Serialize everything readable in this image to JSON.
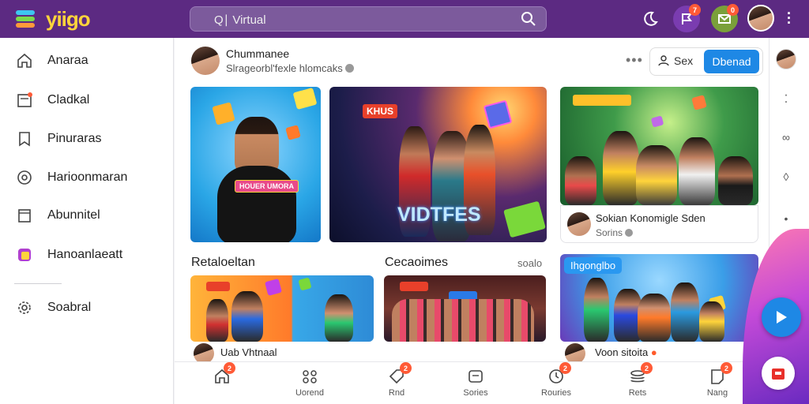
{
  "app": {
    "brand": "yiigo",
    "brand_color": "#ffd43b",
    "topbar_color": "#5c2a82",
    "accent": "#1e88e5"
  },
  "search": {
    "value": "Q∣ Virtual"
  },
  "topbar": {
    "notifications_badge": "7",
    "messages_badge": "0"
  },
  "sidebar": {
    "items": [
      {
        "label": "Anaraa",
        "icon": "home-icon"
      },
      {
        "label": "Cladkal",
        "icon": "inbox-icon"
      },
      {
        "label": "Pinuraras",
        "icon": "bookmark-icon"
      },
      {
        "label": "Harioonmaran",
        "icon": "target-icon"
      },
      {
        "label": "Abunnitel",
        "icon": "calendar-icon"
      },
      {
        "label": "Hanoanlaeatt",
        "icon": "app-icon"
      },
      {
        "label": "Soabral",
        "icon": "gear-icon"
      }
    ]
  },
  "post": {
    "author": "Chummanee",
    "subtitle": "Slrageorbl'fexle hlomcaks",
    "secondary_button": "Sex",
    "primary_button": "Dbenad"
  },
  "featured": {
    "img1_banner": "HOUER UMORA",
    "img2_banner": "KHUS",
    "img2_title": "VIDTFES"
  },
  "info_card": {
    "title": "Sokian Konomigle Sden",
    "meta": "Sorins"
  },
  "sections": [
    {
      "title": "Retaloeltan",
      "extra": ""
    },
    {
      "title": "Cecaoimes",
      "extra": "soalo"
    }
  ],
  "tag_chip": "Ihgonglbo",
  "strip": [
    {
      "text": "Uab Vhtnaal"
    },
    {
      "text": "Voon sitoita"
    }
  ],
  "bottom_nav": [
    {
      "label": "",
      "icon": "home-icon",
      "badge": "2"
    },
    {
      "label": "Uorend",
      "icon": "grid-icon",
      "badge": ""
    },
    {
      "label": "Rnd",
      "icon": "tag-icon",
      "badge": "2"
    },
    {
      "label": "Sories",
      "icon": "chat-icon",
      "badge": ""
    },
    {
      "label": "Rouries",
      "icon": "clock-icon",
      "badge": "2"
    },
    {
      "label": "Rets",
      "icon": "stack-icon",
      "badge": "2"
    },
    {
      "label": "Nang",
      "icon": "note-icon",
      "badge": "2"
    }
  ]
}
